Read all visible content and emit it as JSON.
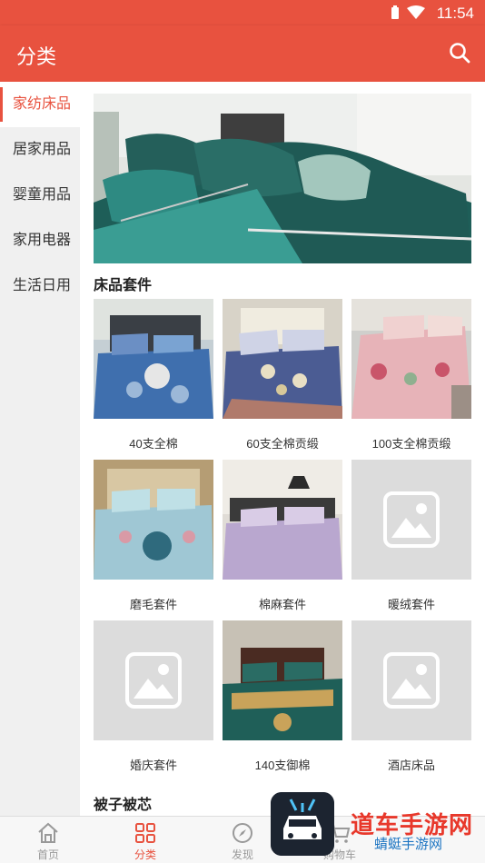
{
  "status_bar": {
    "time": "11:54"
  },
  "app_bar": {
    "title": "分类",
    "search_icon": "search-icon"
  },
  "sidebar": {
    "items": [
      {
        "label": "家纺床品",
        "active": true
      },
      {
        "label": "居家用品",
        "active": false
      },
      {
        "label": "婴童用品",
        "active": false
      },
      {
        "label": "家用电器",
        "active": false
      },
      {
        "label": "生活日用",
        "active": false
      }
    ]
  },
  "main": {
    "banner_icon": "bedding-photo",
    "sections": [
      {
        "title": "床品套件",
        "items": [
          {
            "label": "40支全棉",
            "image": "bedding-photo"
          },
          {
            "label": "60支全棉贡缎",
            "image": "bedding-photo"
          },
          {
            "label": "100支全棉贡缎",
            "image": "bedding-photo"
          },
          {
            "label": "磨毛套件",
            "image": "bedding-photo"
          },
          {
            "label": "棉麻套件",
            "image": "bedding-photo"
          },
          {
            "label": "暖绒套件",
            "image": "placeholder-image-icon"
          },
          {
            "label": "婚庆套件",
            "image": "placeholder-image-icon"
          },
          {
            "label": "140支御棉",
            "image": "bedding-photo"
          },
          {
            "label": "酒店床品",
            "image": "placeholder-image-icon"
          }
        ]
      },
      {
        "title": "被子被芯",
        "items": []
      }
    ]
  },
  "bottom_nav": {
    "tabs": [
      {
        "label": "首页",
        "icon": "home-icon",
        "active": false
      },
      {
        "label": "分类",
        "icon": "category-grid-icon",
        "active": true
      },
      {
        "label": "发现",
        "icon": "discover-icon",
        "active": false
      },
      {
        "label": "购物车",
        "icon": "cart-icon",
        "active": false
      }
    ]
  },
  "watermark": {
    "text": "道车手游网",
    "sub": "蜻蜓手游网",
    "icon": "watermark-logo"
  },
  "colors": {
    "accent": "#e8523f",
    "sidebar_bg": "#f0f0f0",
    "placeholder": "#e3e3e3"
  }
}
